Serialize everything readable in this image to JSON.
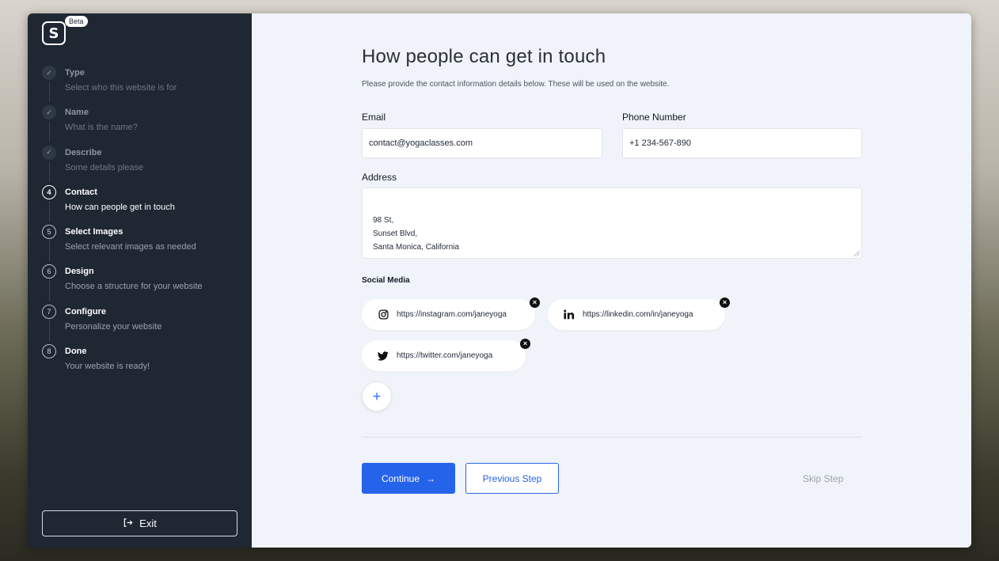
{
  "app": {
    "logo_letter": "S",
    "beta_label": "Beta"
  },
  "steps": [
    {
      "number": "✓",
      "title": "Type",
      "subtitle": "Select who this website is for",
      "state": "done"
    },
    {
      "number": "✓",
      "title": "Name",
      "subtitle": "What is the name?",
      "state": "done"
    },
    {
      "number": "✓",
      "title": "Describe",
      "subtitle": "Some details please",
      "state": "done"
    },
    {
      "number": "4",
      "title": "Contact",
      "subtitle": "How can people get in touch",
      "state": "active"
    },
    {
      "number": "5",
      "title": "Select Images",
      "subtitle": "Select relevant images as needed",
      "state": "upcoming"
    },
    {
      "number": "6",
      "title": "Design",
      "subtitle": "Choose a structure for your website",
      "state": "upcoming"
    },
    {
      "number": "7",
      "title": "Configure",
      "subtitle": "Personalize your website",
      "state": "upcoming"
    },
    {
      "number": "8",
      "title": "Done",
      "subtitle": "Your website is ready!",
      "state": "upcoming"
    }
  ],
  "exit_label": "Exit",
  "page": {
    "title": "How people can get in touch",
    "description": "Please provide the contact information details below. These will be used on the website."
  },
  "form": {
    "email_label": "Email",
    "email_value": "contact@yogaclasses.com",
    "phone_label": "Phone Number",
    "phone_value": "+1 234-567-890",
    "address_label": "Address",
    "address_value": "98 St,\nSunset Blvd,\nSanta Monica, California",
    "social_label": "Social Media",
    "social_links": [
      {
        "icon": "instagram-icon",
        "url": "https://instagram.com/janeyoga"
      },
      {
        "icon": "linkedin-icon",
        "url": "https://linkedin.com/in/janeyoga"
      },
      {
        "icon": "twitter-icon",
        "url": "https://twitter.com/janeyoga"
      }
    ],
    "add_label": "+"
  },
  "actions": {
    "continue_label": "Continue",
    "continue_arrow": "→",
    "previous_label": "Previous Step",
    "skip_label": "Skip Step"
  },
  "colors": {
    "sidebar_bg": "#1f2733",
    "main_bg": "#f0f3fa",
    "accent": "#2563eb"
  }
}
